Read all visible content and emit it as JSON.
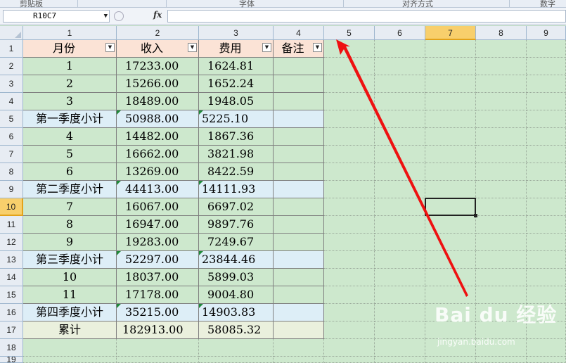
{
  "ribbon": {
    "groups": [
      "剪贴板",
      "字体",
      "对齐方式",
      "数字"
    ]
  },
  "formula_bar": {
    "name_box": "R10C7",
    "fx_label": "fx",
    "formula": ""
  },
  "columns": [
    "1",
    "2",
    "3",
    "4",
    "5",
    "6",
    "7",
    "8",
    "9"
  ],
  "rows": [
    "1",
    "2",
    "3",
    "4",
    "5",
    "6",
    "7",
    "8",
    "9",
    "10",
    "11",
    "12",
    "13",
    "14",
    "15",
    "16",
    "17",
    "18",
    "19"
  ],
  "selected": {
    "row": "10",
    "column": "7"
  },
  "table": {
    "headers": [
      "月份",
      "收入",
      "费用",
      "备注"
    ],
    "body": [
      {
        "month": "1",
        "income": "17233.00",
        "expense": "1624.81",
        "note": "",
        "kind": "month"
      },
      {
        "month": "2",
        "income": "15266.00",
        "expense": "1652.24",
        "note": "",
        "kind": "month"
      },
      {
        "month": "3",
        "income": "18489.00",
        "expense": "1948.05",
        "note": "",
        "kind": "month"
      },
      {
        "month": "第一季度小计",
        "income": "50988.00",
        "expense": "5225.10",
        "note": "",
        "kind": "subtotal"
      },
      {
        "month": "4",
        "income": "14482.00",
        "expense": "1867.36",
        "note": "",
        "kind": "month"
      },
      {
        "month": "5",
        "income": "16662.00",
        "expense": "3821.98",
        "note": "",
        "kind": "month"
      },
      {
        "month": "6",
        "income": "13269.00",
        "expense": "8422.59",
        "note": "",
        "kind": "month"
      },
      {
        "month": "第二季度小计",
        "income": "44413.00",
        "expense": "14111.93",
        "note": "",
        "kind": "subtotal"
      },
      {
        "month": "7",
        "income": "16067.00",
        "expense": "6697.02",
        "note": "",
        "kind": "month"
      },
      {
        "month": "8",
        "income": "16947.00",
        "expense": "9897.76",
        "note": "",
        "kind": "month"
      },
      {
        "month": "9",
        "income": "19283.00",
        "expense": "7249.67",
        "note": "",
        "kind": "month"
      },
      {
        "month": "第三季度小计",
        "income": "52297.00",
        "expense": "23844.46",
        "note": "",
        "kind": "subtotal"
      },
      {
        "month": "10",
        "income": "18037.00",
        "expense": "5899.03",
        "note": "",
        "kind": "month"
      },
      {
        "month": "11",
        "income": "17178.00",
        "expense": "9004.80",
        "note": "",
        "kind": "month"
      },
      {
        "month": "第四季度小计",
        "income": "35215.00",
        "expense": "14903.83",
        "note": "",
        "kind": "subtotal"
      },
      {
        "month": "累计",
        "income": "182913.00",
        "expense": "58085.32",
        "note": "",
        "kind": "total"
      }
    ]
  },
  "colors": {
    "sheet_bg": "#cde8cd",
    "header_fill": "#fbe3d6",
    "subtotal_fill": "#ddeef7",
    "total_fill": "#eaf0dd",
    "selected_header": "#f8cf6c",
    "arrow": "#ee1111"
  },
  "watermark": {
    "brand": "Bai du 经验",
    "sub": "jingyan.baidu.com"
  }
}
